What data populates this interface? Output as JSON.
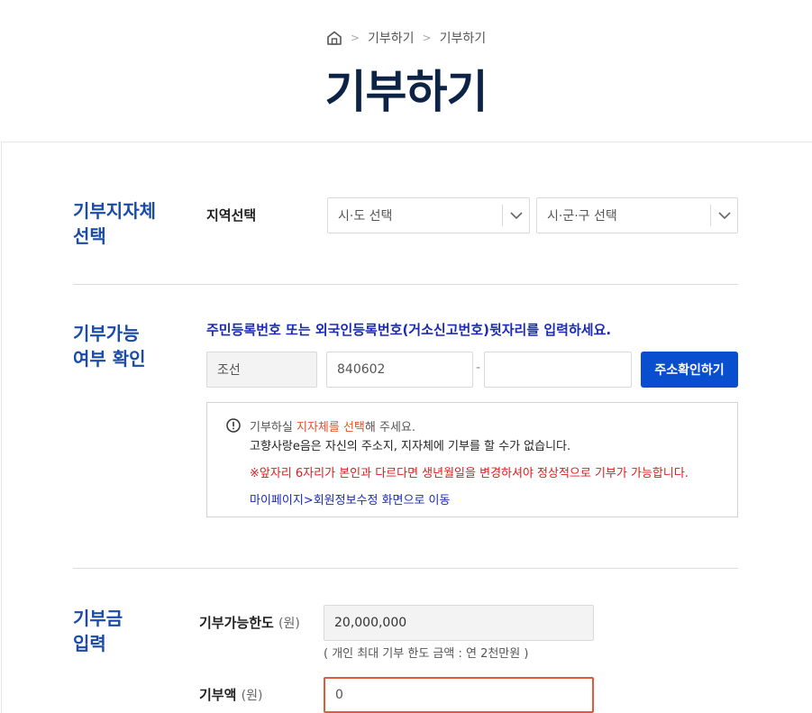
{
  "breadcrumb": {
    "home_icon": "home-icon",
    "items": [
      "기부하기",
      "기부하기"
    ]
  },
  "page_title": "기부하기",
  "section_region": {
    "title_line1": "기부지자체",
    "title_line2": "선택",
    "label": "지역선택",
    "select_province": "시·도 선택",
    "select_city": "시·군·구 선택"
  },
  "section_verify": {
    "title_line1": "기부가능",
    "title_line2": "여부 확인",
    "instruction": "주민등록번호 또는 외국인등록번호(거소신고번호)뒷자리를 입력하세요.",
    "name_value": "조선",
    "id_front_value": "840602",
    "dash": "-",
    "id_back_value": "",
    "check_button": "주소확인하기",
    "notice": {
      "line1_prefix": "기부하실 ",
      "line1_highlight": "지자체를 선택",
      "line1_suffix": "해 주세요.",
      "line2": "고향사랑e음은 자신의 주소지, 지자체에 기부를 할 수가 없습니다.",
      "line3": "※앞자리 6자리가 본인과 다르다면 생년월일을 변경하셔야 정상적으로 기부가 가능합니다.",
      "line4": "마이페이지>회원정보수정 화면으로 이동"
    }
  },
  "section_amount": {
    "title_line1": "기부금",
    "title_line2": "입력",
    "limit_label": "기부가능한도",
    "unit": "(원)",
    "limit_value": "20,000,000",
    "limit_hint": "( 개인 최대 기부 한도 금액 : 연 2천만원 )",
    "amount_label": "기부액",
    "amount_value": "0"
  },
  "colors": {
    "title_navy": "#0d2346",
    "section_blue": "#1a4ba8",
    "primary_button": "#0a4ed0",
    "highlight_orange": "#e5502a",
    "warning_red": "#e11a1a",
    "link_blue": "#1a2ab5",
    "error_border": "#e35a3a"
  }
}
